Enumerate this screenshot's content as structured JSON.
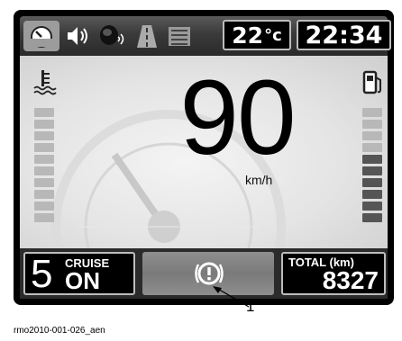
{
  "header": {
    "temperature": "22",
    "temperature_unit": "°c",
    "clock": "22:34"
  },
  "icons": [
    "speedometer-icon",
    "speaker-icon",
    "headset-icon",
    "road-icon",
    "list-icon",
    "coolant-temperature-icon",
    "fuel-pump-icon",
    "warning-icon"
  ],
  "speed": {
    "value": "90",
    "unit": "km/h"
  },
  "gauges": {
    "coolant_level": 0.0,
    "fuel_level": 0.6
  },
  "cruise": {
    "setting": "5",
    "label": "CRUISE",
    "state": "ON"
  },
  "odometer": {
    "label": "TOTAL (km)",
    "value": "8327"
  },
  "callout": "1",
  "caption": "rmo2010-001-026_aen",
  "colors": {
    "frame": "#000000",
    "segment_off": "#b8b8b8",
    "segment_on": "#555555"
  }
}
